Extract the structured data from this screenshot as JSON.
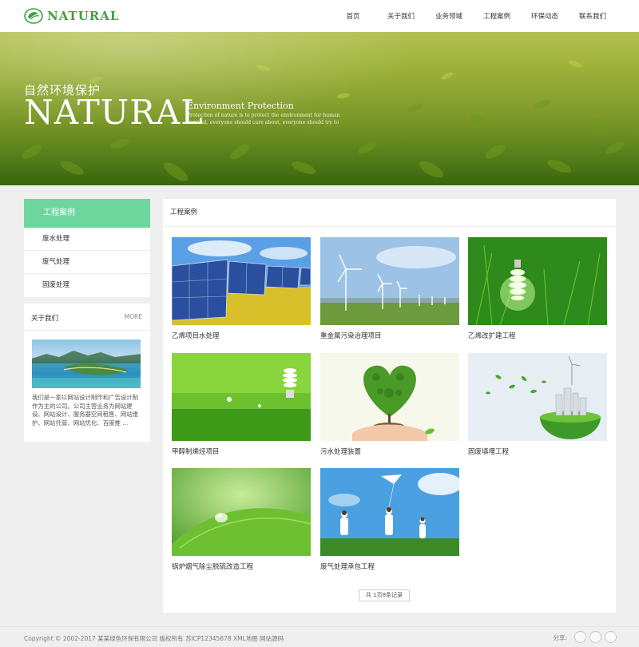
{
  "header": {
    "logo_text": "NATURAL",
    "nav": [
      "首页",
      "关于我们",
      "业务领域",
      "工程案例",
      "环保动态",
      "联系我们"
    ]
  },
  "banner": {
    "cn_title": "自然环境保护",
    "big_title": "NATURAL",
    "en_title": "Environment Protection",
    "en_sub": "Protection of nature is to protect the environment for human survival, everyone should care about, everyone should try to"
  },
  "sidebar": {
    "title": "工程案例",
    "items": [
      "废水处理",
      "废气处理",
      "固废处理"
    ]
  },
  "about": {
    "title": "关于我们",
    "more": "MORE",
    "text": "我们是一家以网站设计制作和广告设计制作为主的公司。公司主营业务为网站建设、网站设计、服务器空间租售、网站维护、网站托管、网站优化、百度推 ..."
  },
  "main": {
    "title": "工程案例",
    "cards": [
      {
        "label": "乙烯项目水处理"
      },
      {
        "label": "重金属污染治理项目"
      },
      {
        "label": "乙烯改扩建工程"
      },
      {
        "label": "甲醇制烯烃项目"
      },
      {
        "label": "污水处理装置"
      },
      {
        "label": "固废填埋工程"
      },
      {
        "label": "锅炉烟气除尘脱硫改造工程"
      },
      {
        "label": "废气处理承包工程"
      }
    ],
    "pager": "共 1页8条记录"
  },
  "footer": {
    "copyright": "Copyright © 2002-2017 某某绿色环保有限公司 版权所有  苏ICP12345678  XML地图  网站源码",
    "share_label": "分享:"
  },
  "colors": {
    "brand_green": "#3aa33e",
    "sidebar_active": "#6dd69d"
  }
}
